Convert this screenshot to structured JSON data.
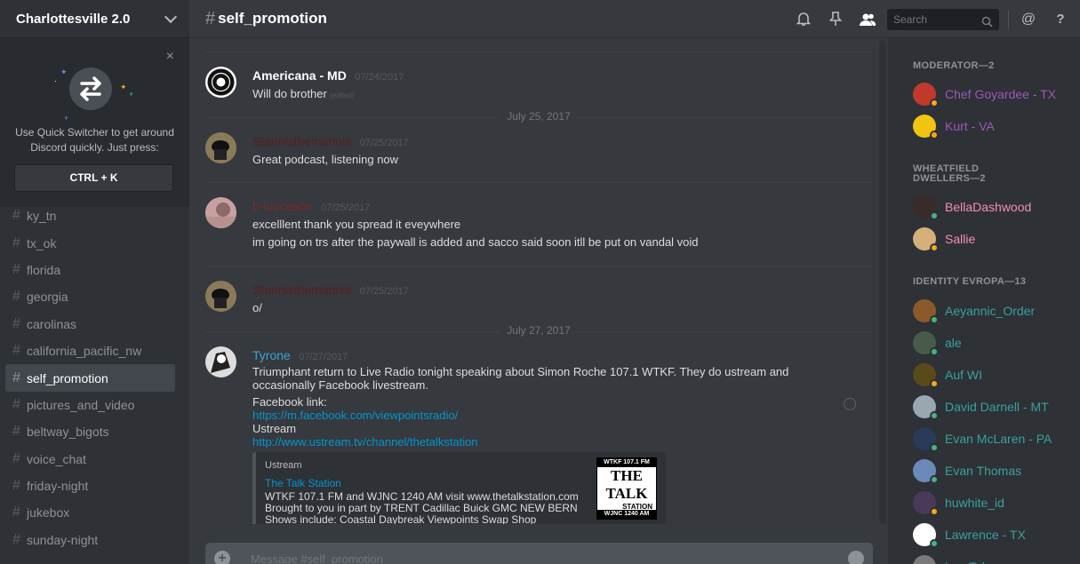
{
  "server": {
    "name": "Charlottesville 2.0"
  },
  "quick_switcher": {
    "text": "Use Quick Switcher to get around Discord quickly. Just press:",
    "shortcut": "CTRL + K",
    "close": "×"
  },
  "channels": [
    {
      "name": "ky_tn"
    },
    {
      "name": "tx_ok"
    },
    {
      "name": "florida"
    },
    {
      "name": "georgia"
    },
    {
      "name": "carolinas"
    },
    {
      "name": "california_pacific_nw"
    },
    {
      "name": "self_promotion",
      "active": true
    },
    {
      "name": "pictures_and_video"
    },
    {
      "name": "beltway_bigots"
    },
    {
      "name": "voice_chat"
    },
    {
      "name": "friday-night"
    },
    {
      "name": "jukebox"
    },
    {
      "name": "sunday-night"
    }
  ],
  "header": {
    "channel": "self_promotion",
    "search_placeholder": "Search",
    "icons": [
      "bell-icon",
      "pin-icon",
      "members-icon",
      "search-icon",
      "mention-icon",
      "help-icon"
    ],
    "at": "@",
    "help": "?"
  },
  "messages": [
    {
      "author": "Americana - MD",
      "color": "#ffffff",
      "timestamp": "07/24/2017",
      "lines": [
        "Will do brother"
      ],
      "edited": "(edited)"
    },
    {
      "date_separator": "July 25, 2017"
    },
    {
      "author": "Stannisthemannis",
      "color": "#5a1e1e",
      "timestamp": "07/25/2017",
      "lines": [
        "Great podcast, listening now"
      ]
    },
    {
      "author": "b-luccason",
      "color": "#7a2a2a",
      "timestamp": "07/25/2017",
      "lines": [
        "excelllent thank you spread it eveywhere",
        "im going on trs after the paywall is added and sacco said soon itll be put on vandal void"
      ]
    },
    {
      "author": "Stannisthemannis",
      "color": "#5a1e1e",
      "timestamp": "07/25/2017",
      "lines": [
        "o/"
      ]
    },
    {
      "date_separator": "July 27, 2017"
    },
    {
      "author": "Tyrone",
      "color": "#3aa1dd",
      "timestamp": "07/27/2017",
      "lines": [
        "Triumphant return to Live Radio tonight speaking about Simon Roche 107.1 WTKF. They do ustream and occasionally Facebook livestream.",
        "Facebook link:"
      ],
      "link1": "https://m.facebook.com/viewpointsradio/",
      "label2": "Ustream",
      "link2": "http://www.ustream.tv/channel/thetalkstation",
      "embed": {
        "provider": "Ustream",
        "title": "The Talk Station",
        "description": "WTKF 107.1 FM and WJNC 1240 AM visit www.thetalkstation.com Brought to you in part by TRENT Cadillac Buick GMC NEW BERN Shows include: Coastal Daybreak Viewpoints Swap Shop",
        "thumb_top": "WTKF 107.1 FM",
        "thumb_main": "THE TALK",
        "thumb_sub": "STATION",
        "thumb_bottom": "WJNC 1240 AM"
      }
    }
  ],
  "composer": {
    "placeholder": "Message #self_promotion",
    "plus": "+"
  },
  "members": {
    "groups": [
      {
        "title": "MODERATOR—2",
        "items": [
          {
            "name": "Chef Goyardee - TX",
            "color": "#9b59b6",
            "status": "#faa61a",
            "avatar": "#c0392b"
          },
          {
            "name": "Kurt - VA",
            "color": "#9b59b6",
            "status": "#faa61a",
            "avatar": "#f1c40f"
          }
        ]
      },
      {
        "title": "WHEATFIELD DWELLERS—2",
        "items": [
          {
            "name": "BellaDashwood",
            "color": "#f48fb1",
            "status": "#43b581",
            "avatar": "#3a2a2a"
          },
          {
            "name": "Sallie",
            "color": "#f48fb1",
            "status": "#faa61a",
            "avatar": "#d4b07a"
          }
        ]
      },
      {
        "title": "IDENTITY EVROPA—13",
        "items": [
          {
            "name": "Aeyannic_Order",
            "color": "#3aa19a",
            "status": "#43b581",
            "avatar": "#8a5a2a"
          },
          {
            "name": "ale",
            "color": "#3aa19a",
            "status": "#43b581",
            "avatar": "#4a5a4a"
          },
          {
            "name": "Auf WI",
            "color": "#3aa19a",
            "status": "#faa61a",
            "avatar": "#5a4a1a"
          },
          {
            "name": "David Darnell - MT",
            "color": "#3aa19a",
            "status": "#43b581",
            "avatar": "#9aa6b0"
          },
          {
            "name": "Evan McLaren - PA",
            "color": "#3aa19a",
            "status": "#43b581",
            "avatar": "#2a3a5a"
          },
          {
            "name": "Evan Thomas",
            "color": "#3aa19a",
            "status": "#43b581",
            "avatar": "#6a8aba"
          },
          {
            "name": "huwhite_id",
            "color": "#3aa19a",
            "status": "#faa61a",
            "avatar": "#4a3a5a"
          },
          {
            "name": "Lawrence - TX",
            "color": "#3aa19a",
            "status": "#43b581",
            "avatar": "#ffffff"
          },
          {
            "name": "Lee Taleroy",
            "color": "#3aa19a",
            "status": "#43b581",
            "avatar": "#7a7a7a"
          }
        ]
      }
    ]
  }
}
